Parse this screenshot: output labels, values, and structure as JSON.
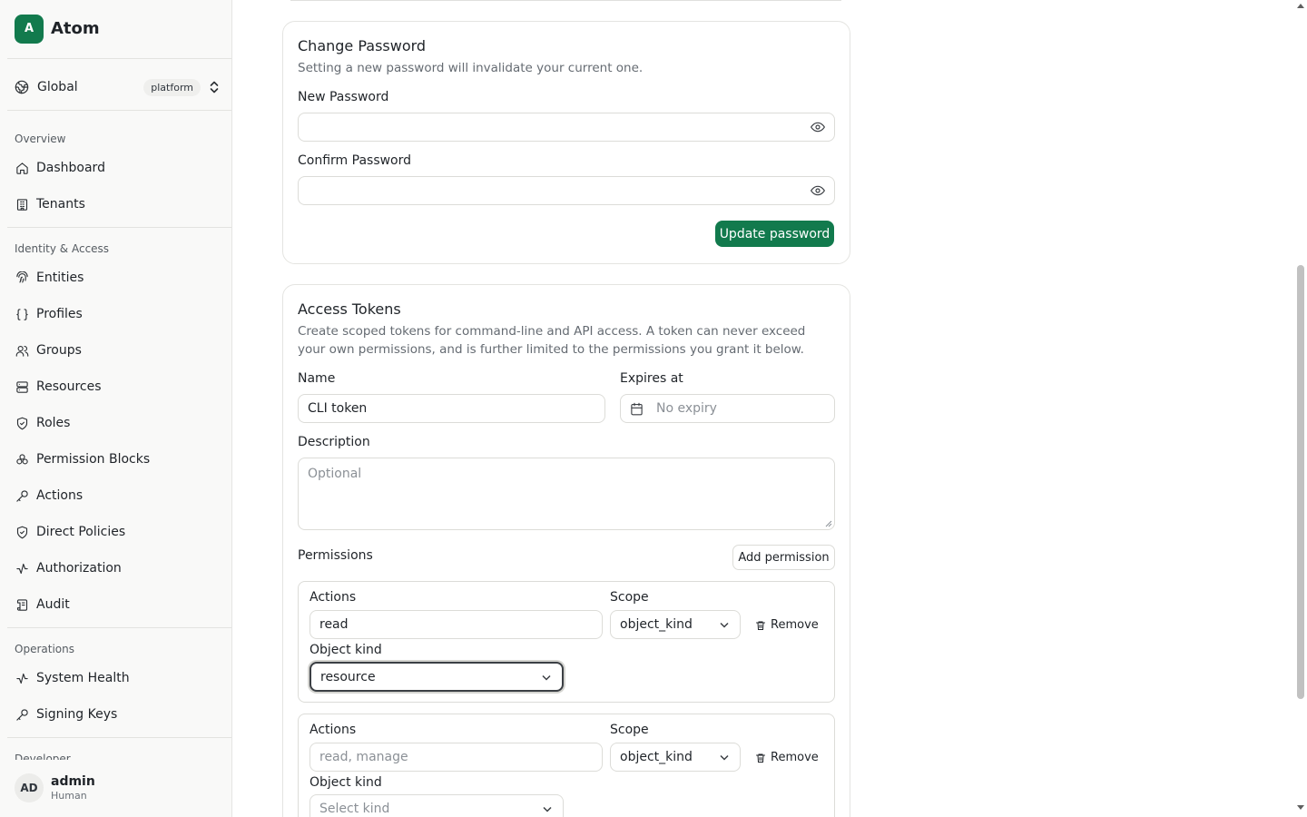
{
  "brand": {
    "logo_letter": "A",
    "name": "Atom"
  },
  "scope": {
    "label": "Global",
    "badge": "platform"
  },
  "nav": {
    "overview": {
      "title": "Overview",
      "items": [
        {
          "label": "Dashboard",
          "icon": "home-icon"
        },
        {
          "label": "Tenants",
          "icon": "building-icon"
        }
      ]
    },
    "identity": {
      "title": "Identity & Access",
      "items": [
        {
          "label": "Entities",
          "icon": "fingerprint-icon"
        },
        {
          "label": "Profiles",
          "icon": "braces-icon"
        },
        {
          "label": "Groups",
          "icon": "users-icon"
        },
        {
          "label": "Resources",
          "icon": "server-icon"
        },
        {
          "label": "Roles",
          "icon": "shield-check-icon"
        },
        {
          "label": "Permission Blocks",
          "icon": "blocks-icon"
        },
        {
          "label": "Actions",
          "icon": "key-icon"
        },
        {
          "label": "Direct Policies",
          "icon": "shield-check-icon"
        },
        {
          "label": "Authorization",
          "icon": "activity-icon"
        },
        {
          "label": "Audit",
          "icon": "scroll-icon"
        }
      ]
    },
    "operations": {
      "title": "Operations",
      "items": [
        {
          "label": "System Health",
          "icon": "activity-icon"
        },
        {
          "label": "Signing Keys",
          "icon": "key-icon"
        }
      ]
    },
    "developer": {
      "title": "Developer"
    }
  },
  "user": {
    "initials": "AD",
    "name": "admin",
    "role": "Human"
  },
  "change_password": {
    "title": "Change Password",
    "description": "Setting a new password will invalidate your current one.",
    "new_label": "New Password",
    "confirm_label": "Confirm Password",
    "submit_label": "Update password"
  },
  "access_tokens": {
    "title": "Access Tokens",
    "description": "Create scoped tokens for command-line and API access. A token can never exceed your own permissions, and is further limited to the permissions you grant it below.",
    "name_label": "Name",
    "name_value": "CLI token",
    "expires_label": "Expires at",
    "expires_placeholder": "No expiry",
    "description_label": "Description",
    "description_placeholder": "Optional",
    "permissions_label": "Permissions",
    "add_permission_label": "Add permission",
    "permissions": [
      {
        "actions_label": "Actions",
        "actions_value": "read",
        "actions_placeholder": "",
        "scope_label": "Scope",
        "scope_value": "object_kind",
        "remove_label": "Remove",
        "kind_label": "Object kind",
        "kind_value": "resource",
        "kind_is_placeholder": false
      },
      {
        "actions_label": "Actions",
        "actions_value": "",
        "actions_placeholder": "read, manage",
        "scope_label": "Scope",
        "scope_value": "object_kind",
        "remove_label": "Remove",
        "kind_label": "Object kind",
        "kind_value": "Select kind",
        "kind_is_placeholder": true
      }
    ]
  },
  "colors": {
    "primary": "#127a4d",
    "border": "#dcdcd8",
    "muted_text": "#656b72"
  }
}
